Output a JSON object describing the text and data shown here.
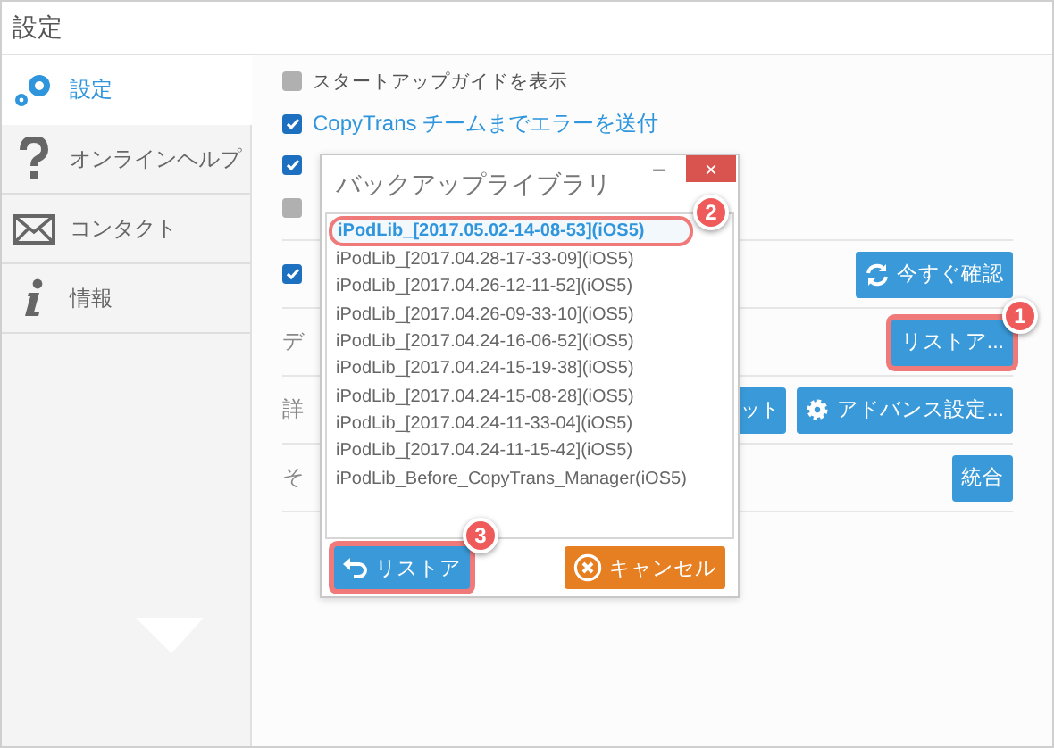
{
  "window": {
    "title": "設定"
  },
  "sidebar": {
    "items": [
      {
        "label": "設定",
        "selected": true
      },
      {
        "label": "オンラインヘルプ",
        "selected": false
      },
      {
        "label": "コンタクト",
        "selected": false
      },
      {
        "label": "情報",
        "selected": false
      }
    ]
  },
  "options": [
    {
      "label": "スタートアップガイドを表示",
      "checked": false,
      "link": false
    },
    {
      "label": "CopyTrans チームまでエラーを送付",
      "checked": true,
      "link": true
    },
    {
      "checked": true
    },
    {
      "checked": false
    }
  ],
  "sections": [
    {
      "checked": true,
      "buttons": [
        {
          "label": "今すぐ確認"
        }
      ]
    },
    {
      "label": "デ",
      "buttons": [
        {
          "label": "リストア...",
          "badge": "1"
        }
      ]
    },
    {
      "label": "詳",
      "buttons": [
        {
          "label": "ット"
        },
        {
          "label": "アドバンス設定..."
        }
      ]
    },
    {
      "label": "そ",
      "buttons": [
        {
          "label": "統合"
        }
      ]
    }
  ],
  "dialog": {
    "title": "バックアップライブラリ",
    "minimize": "−",
    "close": "×",
    "items": [
      {
        "label": "iPodLib_[2017.05.02-14-08-53](iOS5)",
        "selected": true,
        "badge": "2"
      },
      {
        "label": "iPodLib_[2017.04.28-17-33-09](iOS5)",
        "selected": false
      },
      {
        "label": "iPodLib_[2017.04.26-12-11-52](iOS5)",
        "selected": false
      },
      {
        "label": "iPodLib_[2017.04.26-09-33-10](iOS5)",
        "selected": false
      },
      {
        "label": "iPodLib_[2017.04.24-16-06-52](iOS5)",
        "selected": false
      },
      {
        "label": "iPodLib_[2017.04.24-15-19-38](iOS5)",
        "selected": false
      },
      {
        "label": "iPodLib_[2017.04.24-15-08-28](iOS5)",
        "selected": false
      },
      {
        "label": "iPodLib_[2017.04.24-11-33-04](iOS5)",
        "selected": false
      },
      {
        "label": "iPodLib_[2017.04.24-11-15-42](iOS5)",
        "selected": false
      },
      {
        "label": "iPodLib_Before_CopyTrans_Manager(iOS5)",
        "selected": false
      }
    ],
    "buttons": [
      {
        "label": "リストア",
        "kind": "primary",
        "badge": "3"
      },
      {
        "label": "キャンセル",
        "kind": "warning"
      }
    ]
  }
}
